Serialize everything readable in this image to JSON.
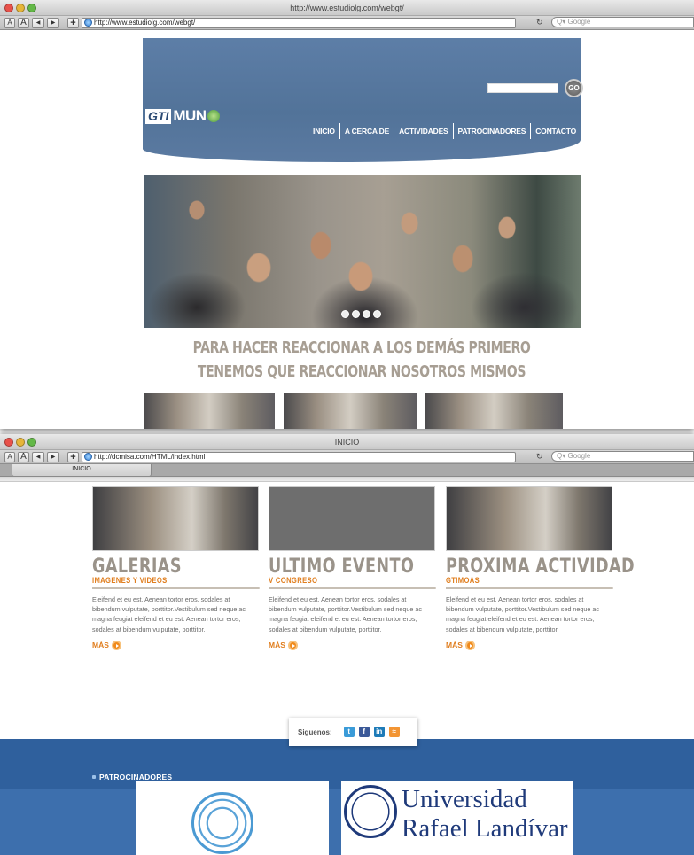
{
  "window1": {
    "title": "http://www.estudiolg.com/webgt/",
    "url": "http://www.estudiolg.com/webgt/",
    "search_placeholder": "Google",
    "site": {
      "logo_left": "GTI",
      "logo_right": "MUN",
      "go_label": "GO",
      "nav": [
        "INICIO",
        "A CERCA DE",
        "ACTIVIDADES",
        "PATROCINADORES",
        "CONTACTO"
      ],
      "slogan": "PARA HACER REACCIONAR A LOS DEMÁS PRIMERO TENEMOS QUE REACCIONAR NOSOTROS MISMOS",
      "slider_dots": 4
    }
  },
  "window2": {
    "title": "INICIO",
    "url": "http://dcmisa.com/HTML/index.html",
    "search_placeholder": "Google",
    "tab_label": "INICIO",
    "columns": [
      {
        "title": "GALERIAS",
        "subtitle": "IMAGENES Y VIDEOS",
        "body": "Eleifend et eu est. Aenean tortor eros, sodales at bibendum vulputate, porttitor.Vestibulum sed neque ac magna feugiat eleifend et eu est. Aenean tortor eros, sodales at bibendum vulputate, porttitor.",
        "more": "MÁS"
      },
      {
        "title": "ULTIMO EVENTO",
        "subtitle": "V CONGRESO",
        "body": "Eleifend et eu est. Aenean tortor eros, sodales at bibendum vulputate, porttitor.Vestibulum sed neque ac magna feugiat eleifend et eu est. Aenean tortor eros, sodales at bibendum vulputate, porttitor.",
        "more": "MÁS"
      },
      {
        "title": "PROXIMA ACTIVIDAD",
        "subtitle": "GTIMOAS",
        "body": "Eleifend et eu est. Aenean tortor eros, sodales at bibendum vulputate, porttitor.Vestibulum sed neque ac magna feugiat eleifend et eu est. Aenean tortor eros, sodales at bibendum vulputate, porttitor.",
        "more": "MÁS"
      }
    ],
    "follow_label": "Siguenos:",
    "social_icons": [
      "twitter-icon",
      "facebook-icon",
      "linkedin-icon",
      "rss-icon"
    ],
    "sponsors_label": "PATROCINADORES",
    "sponsors": [
      "Universidad",
      "Rafael Landívar"
    ],
    "colors": {
      "brand_blue": "#2f609d",
      "accent_orange": "#e07e1e",
      "header_blue": "#5d7ea7"
    }
  }
}
